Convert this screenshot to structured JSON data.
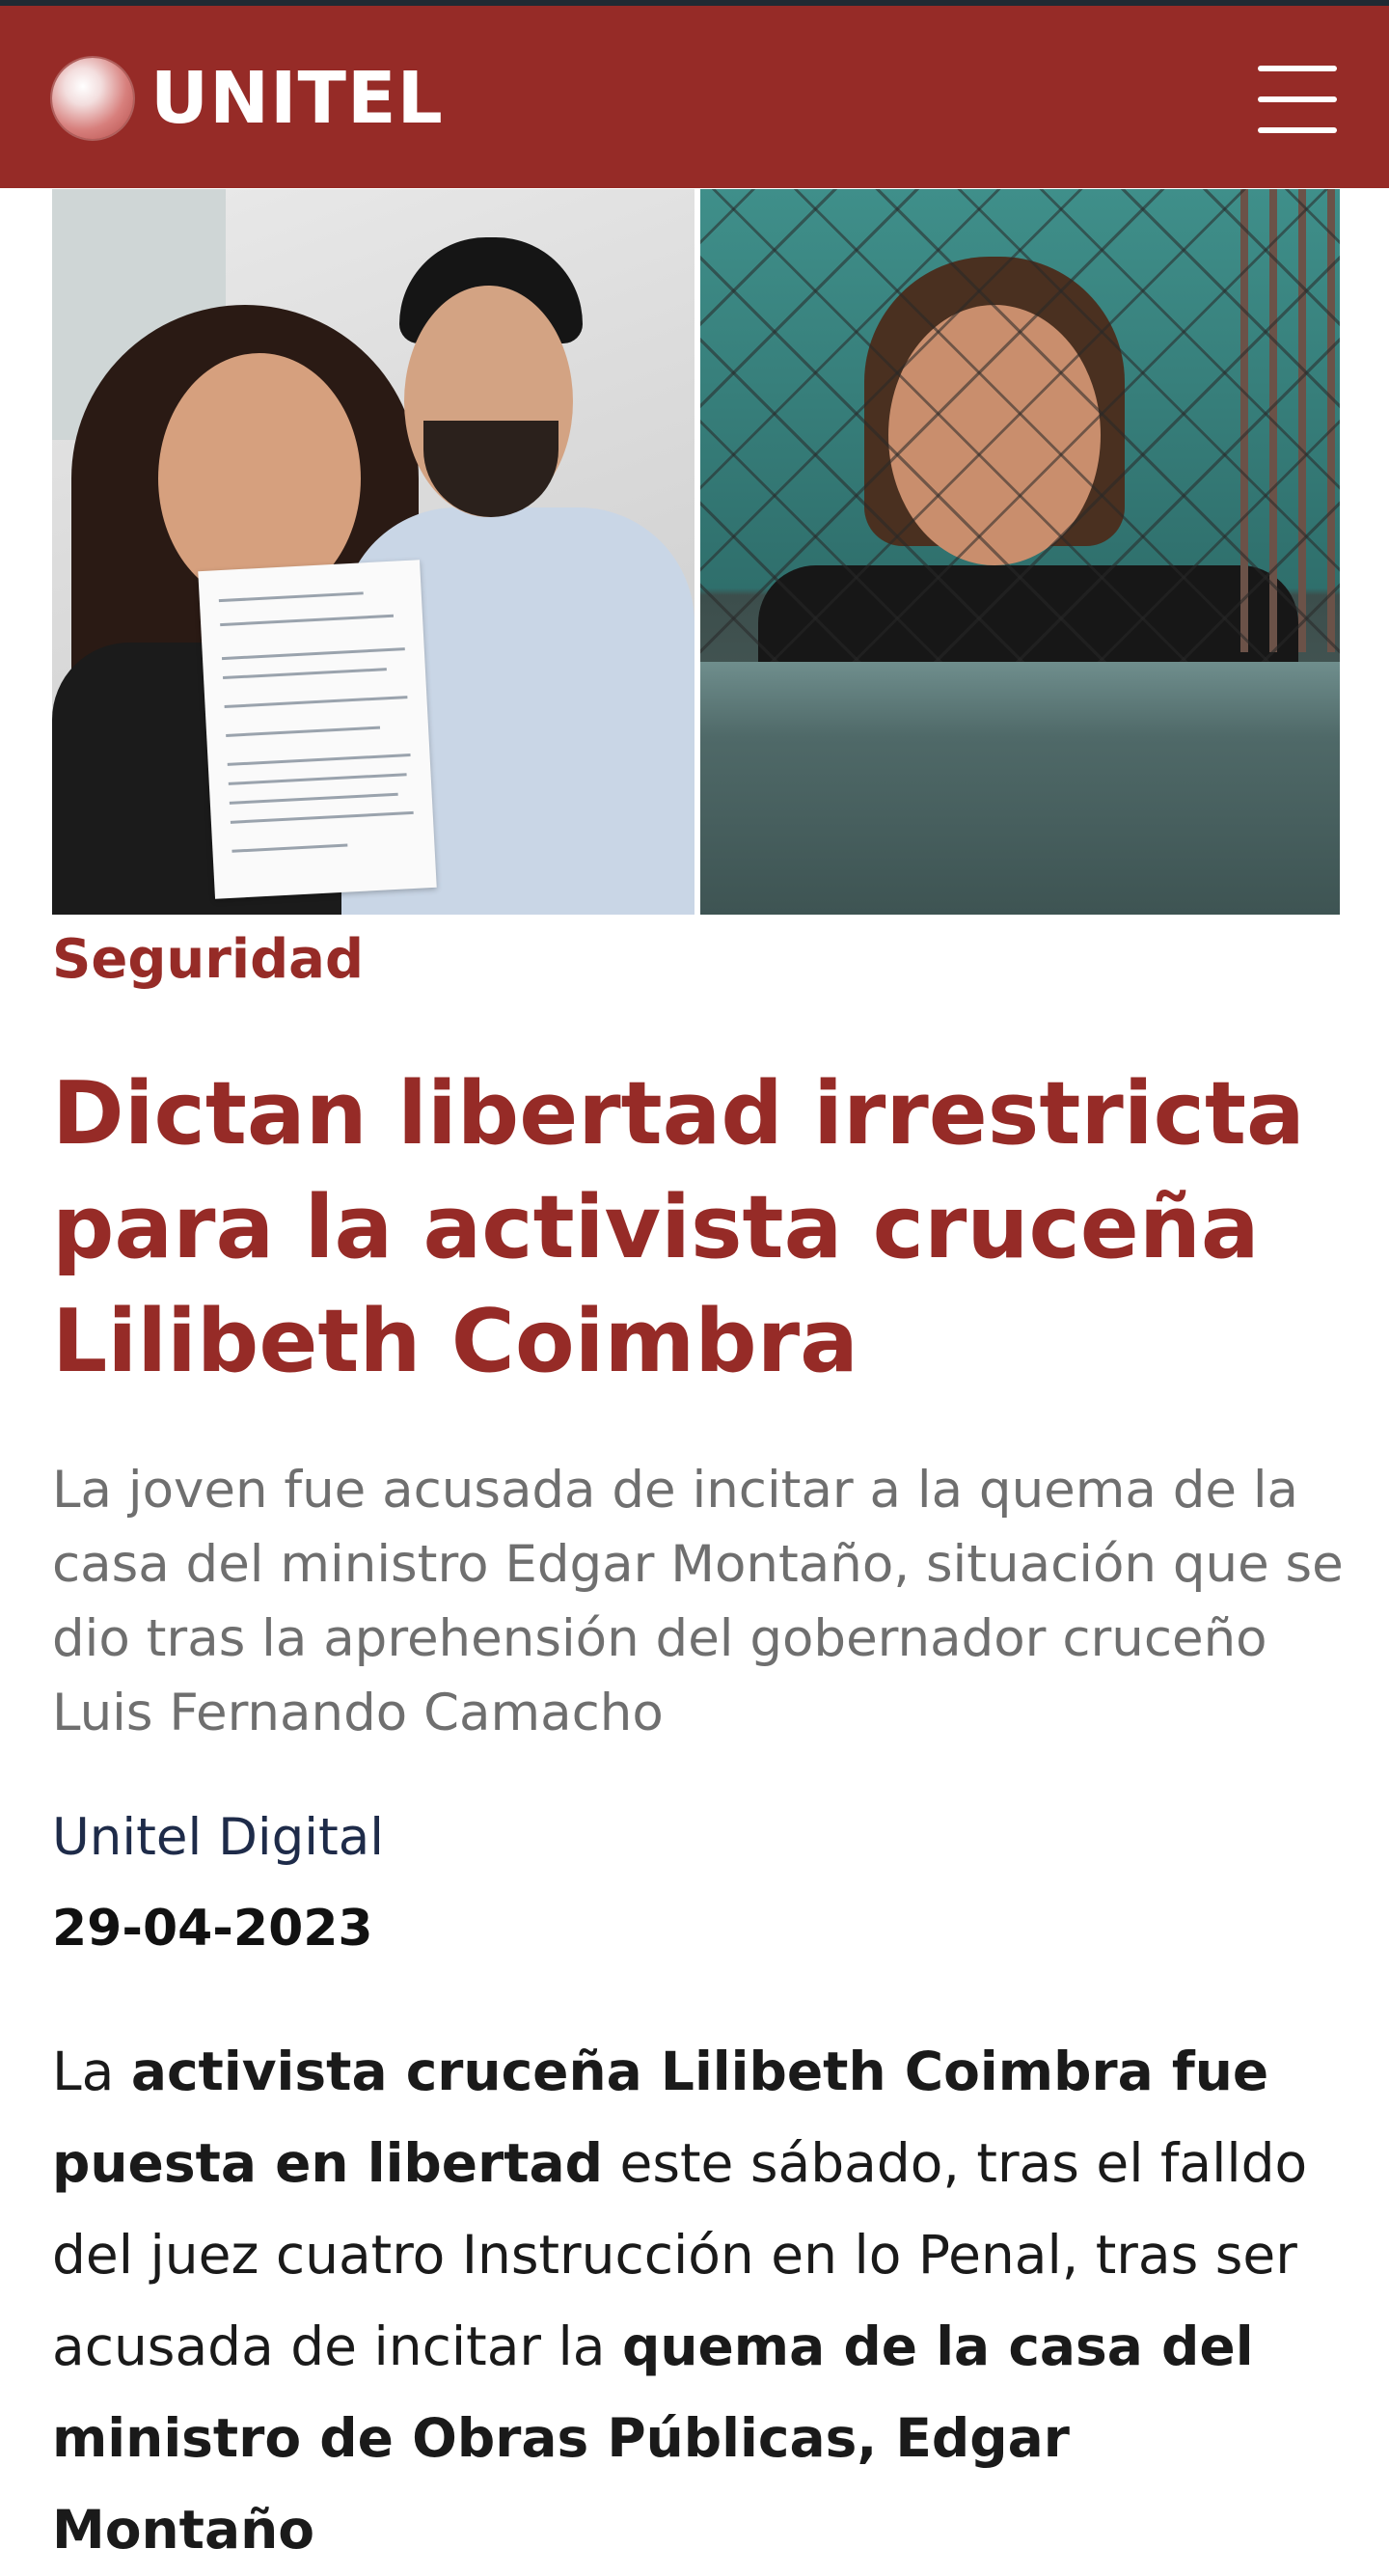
{
  "header": {
    "logo_text": "UNITEL",
    "menu_icon": "hamburger-menu-icon",
    "background_color": "#962b27"
  },
  "article": {
    "category": "Seguridad",
    "headline": "Dictan libertad irrestricta para la activista cruceña Lilibeth Coimbra",
    "summary": "La joven fue acusada de incitar a la quema de la casa del ministro Edgar Montaño, situación que se dio tras la aprehensión del gobernador cruceño Luis Fernando Camacho",
    "author": "Unitel Digital",
    "date": "29-04-2023",
    "body": {
      "part1": "La ",
      "part2_bold": "activista cruceña Lilibeth Coimbra fue puesta en libertad",
      "part3": " este sábado, tras el falldo del juez cuatro Instrucción en lo Penal, tras ser acusada de incitar la ",
      "part4_bold": "quema de la casa del ministro de Obras Públicas, Edgar Montaño"
    }
  },
  "colors": {
    "accent": "#962b27",
    "summary_text": "#6f6f6f",
    "author_text": "#1e2b49"
  }
}
